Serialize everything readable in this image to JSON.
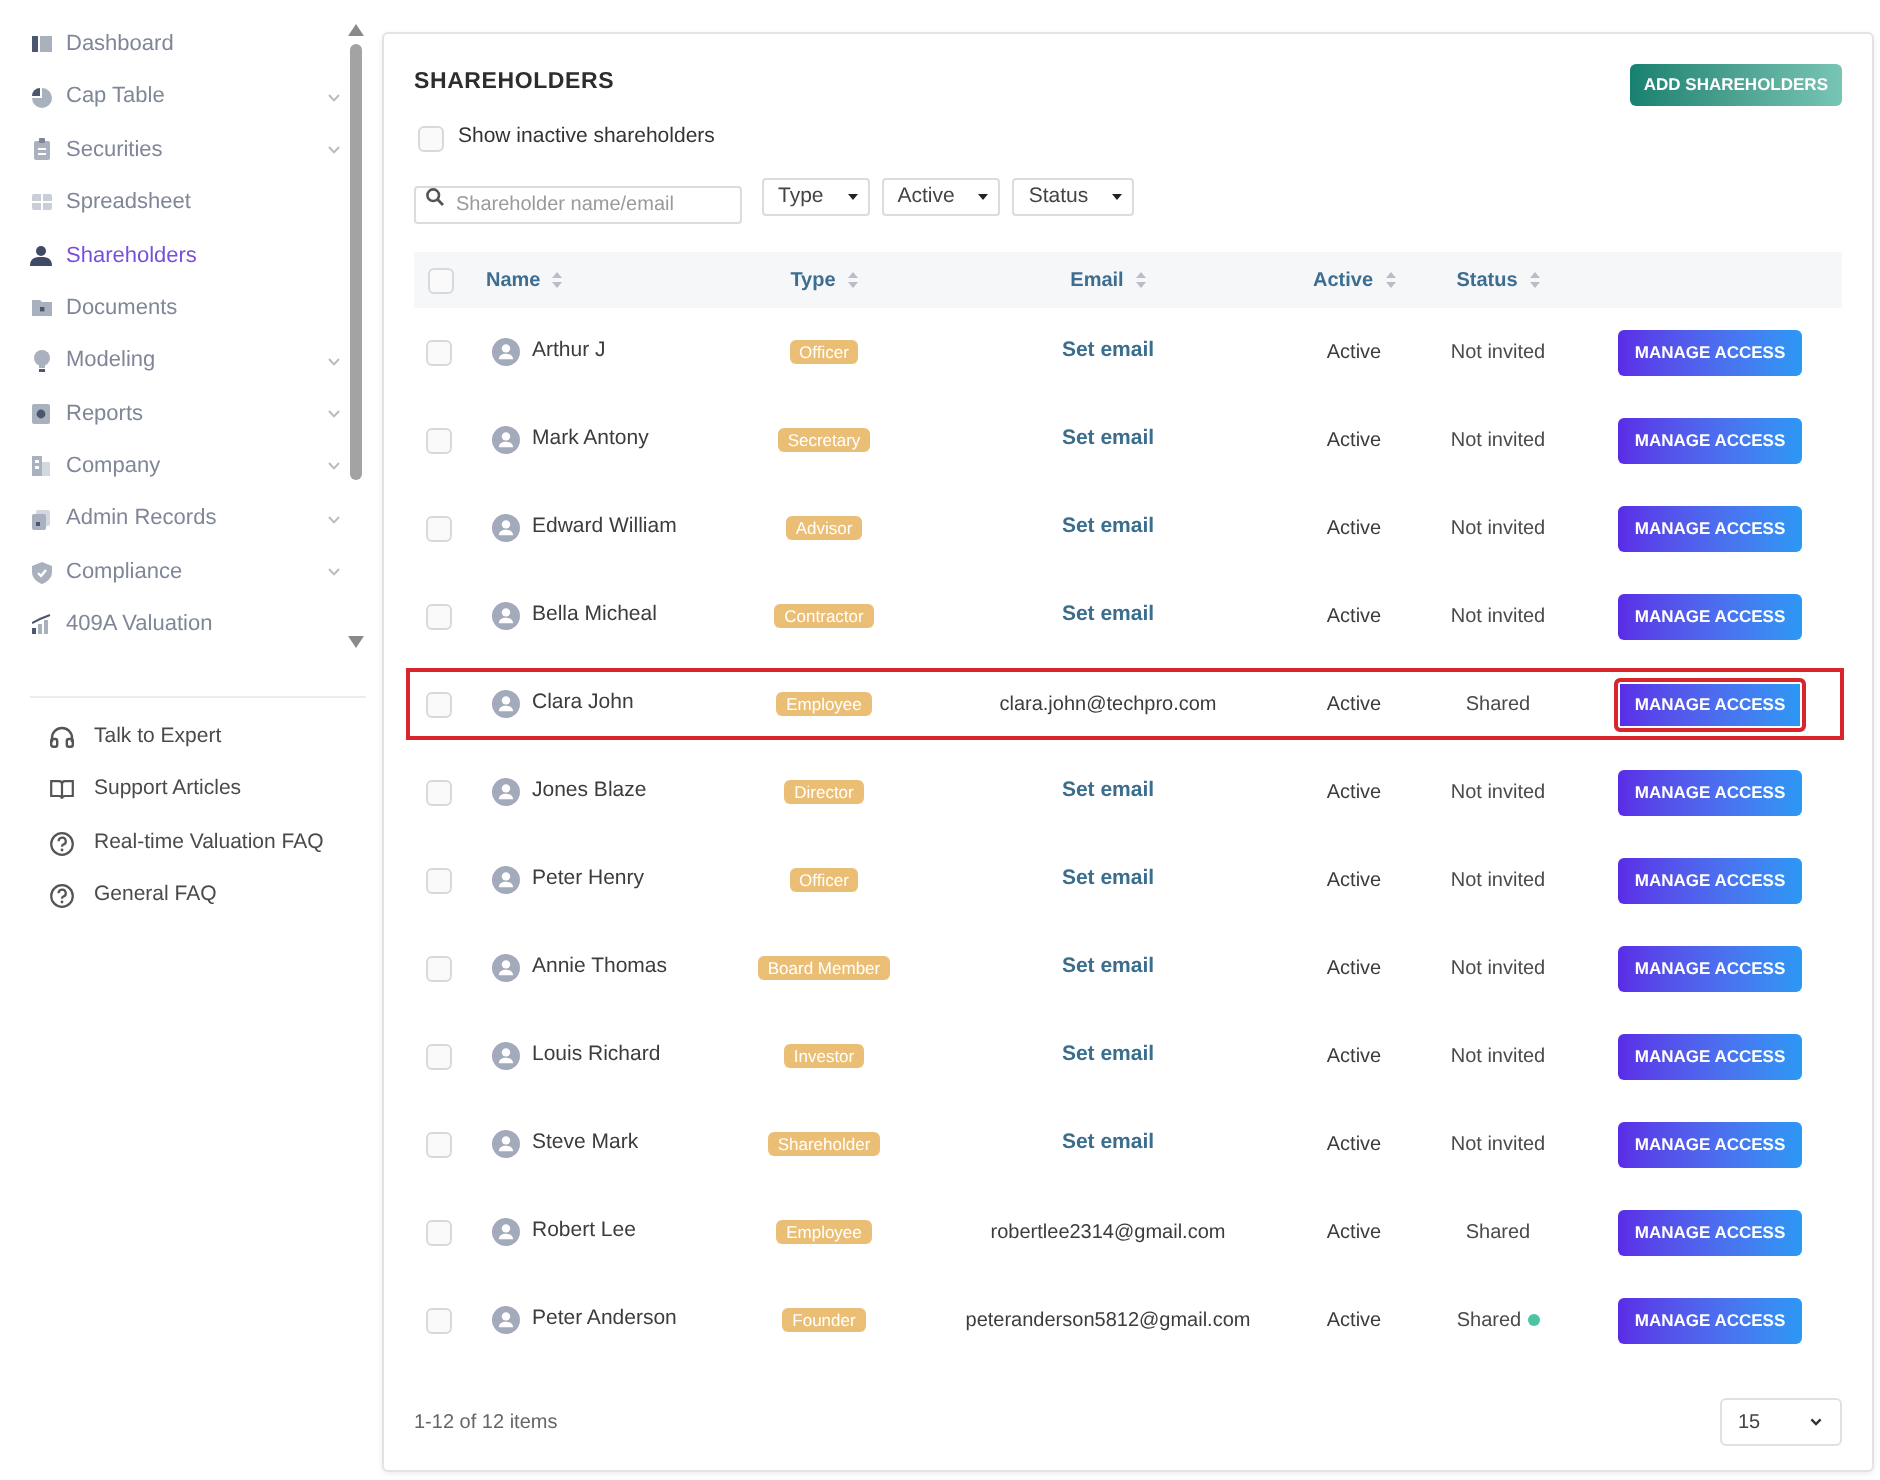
{
  "sidebar": {
    "items": [
      {
        "label": "Dashboard",
        "selected": false,
        "expandable": false
      },
      {
        "label": "Cap Table",
        "selected": false,
        "expandable": true
      },
      {
        "label": "Securities",
        "selected": false,
        "expandable": true
      },
      {
        "label": "Spreadsheet",
        "selected": false,
        "expandable": false
      },
      {
        "label": "Shareholders",
        "selected": true,
        "expandable": false
      },
      {
        "label": "Documents",
        "selected": false,
        "expandable": false
      },
      {
        "label": "Modeling",
        "selected": false,
        "expandable": true
      },
      {
        "label": "Reports",
        "selected": false,
        "expandable": true
      },
      {
        "label": "Company",
        "selected": false,
        "expandable": true
      },
      {
        "label": "Admin Records",
        "selected": false,
        "expandable": true
      },
      {
        "label": "Compliance",
        "selected": false,
        "expandable": true
      },
      {
        "label": "409A Valuation",
        "selected": false,
        "expandable": false
      }
    ],
    "help_links": [
      {
        "label": "Talk to Expert"
      },
      {
        "label": "Support Articles"
      },
      {
        "label": "Real-time Valuation FAQ"
      },
      {
        "label": "General FAQ"
      }
    ]
  },
  "page": {
    "title": "SHAREHOLDERS",
    "add_button": "ADD SHAREHOLDERS",
    "show_inactive": {
      "label": "Show inactive shareholders",
      "checked": false
    },
    "search": {
      "placeholder": "Shareholder name/email"
    },
    "filters": [
      "Type",
      "Active",
      "Status"
    ]
  },
  "table": {
    "select_all_checked": false,
    "columns": [
      "Name",
      "Type",
      "Email",
      "Active",
      "Status"
    ],
    "rows": [
      {
        "checked": false,
        "name": "Arthur J",
        "type": "Officer",
        "email": {
          "kind": "action",
          "text": "Set email"
        },
        "active": "Active",
        "status": "Not invited",
        "indicator": false,
        "action": "MANAGE ACCESS",
        "highlighted": false
      },
      {
        "checked": false,
        "name": "Mark Antony",
        "type": "Secretary",
        "email": {
          "kind": "action",
          "text": "Set email"
        },
        "active": "Active",
        "status": "Not invited",
        "indicator": false,
        "action": "MANAGE ACCESS",
        "highlighted": false
      },
      {
        "checked": false,
        "name": "Edward William",
        "type": "Advisor",
        "email": {
          "kind": "action",
          "text": "Set email"
        },
        "active": "Active",
        "status": "Not invited",
        "indicator": false,
        "action": "MANAGE ACCESS",
        "highlighted": false
      },
      {
        "checked": false,
        "name": "Bella Micheal",
        "type": "Contractor",
        "email": {
          "kind": "action",
          "text": "Set email"
        },
        "active": "Active",
        "status": "Not invited",
        "indicator": false,
        "action": "MANAGE ACCESS",
        "highlighted": false
      },
      {
        "checked": false,
        "name": "Clara John",
        "type": "Employee",
        "email": {
          "kind": "address",
          "text": "clara.john@techpro.com"
        },
        "active": "Active",
        "status": "Shared",
        "indicator": false,
        "action": "MANAGE ACCESS",
        "highlighted": true
      },
      {
        "checked": false,
        "name": "Jones Blaze",
        "type": "Director",
        "email": {
          "kind": "action",
          "text": "Set email"
        },
        "active": "Active",
        "status": "Not invited",
        "indicator": false,
        "action": "MANAGE ACCESS",
        "highlighted": false
      },
      {
        "checked": false,
        "name": "Peter Henry",
        "type": "Officer",
        "email": {
          "kind": "action",
          "text": "Set email"
        },
        "active": "Active",
        "status": "Not invited",
        "indicator": false,
        "action": "MANAGE ACCESS",
        "highlighted": false
      },
      {
        "checked": false,
        "name": "Annie Thomas",
        "type": "Board Member",
        "email": {
          "kind": "action",
          "text": "Set email"
        },
        "active": "Active",
        "status": "Not invited",
        "indicator": false,
        "action": "MANAGE ACCESS",
        "highlighted": false
      },
      {
        "checked": false,
        "name": "Louis Richard",
        "type": "Investor",
        "email": {
          "kind": "action",
          "text": "Set email"
        },
        "active": "Active",
        "status": "Not invited",
        "indicator": false,
        "action": "MANAGE ACCESS",
        "highlighted": false
      },
      {
        "checked": false,
        "name": "Steve Mark",
        "type": "Shareholder",
        "email": {
          "kind": "action",
          "text": "Set email"
        },
        "active": "Active",
        "status": "Not invited",
        "indicator": false,
        "action": "MANAGE ACCESS",
        "highlighted": false
      },
      {
        "checked": false,
        "name": "Robert Lee",
        "type": "Employee",
        "email": {
          "kind": "address",
          "text": "robertlee2314@gmail.com"
        },
        "active": "Active",
        "status": "Shared",
        "indicator": false,
        "action": "MANAGE ACCESS",
        "highlighted": false
      },
      {
        "checked": false,
        "name": "Peter Anderson",
        "type": "Founder",
        "email": {
          "kind": "address",
          "text": "peteranderson5812@gmail.com"
        },
        "active": "Active",
        "status": "Shared",
        "indicator": true,
        "action": "MANAGE ACCESS",
        "highlighted": false
      }
    ]
  },
  "pagination": {
    "summary": "1-12 of 12 items",
    "page_size": "15"
  }
}
